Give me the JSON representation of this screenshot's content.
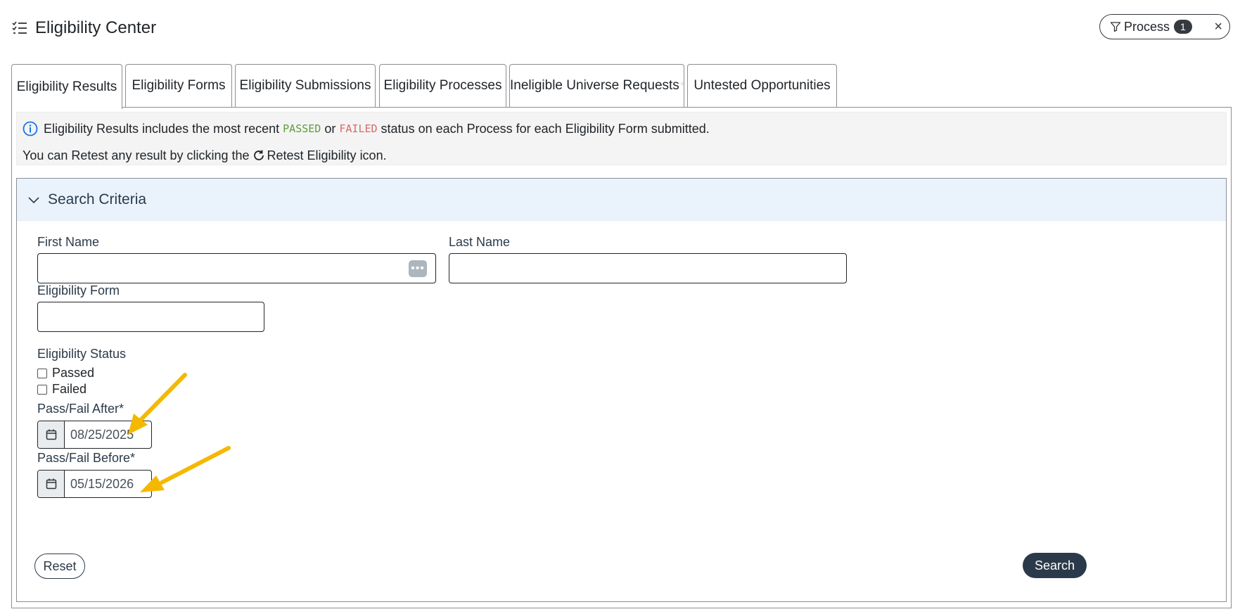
{
  "header": {
    "title": "Eligibility Center",
    "icon": "list-check-icon"
  },
  "filter_pill": {
    "label": "Process",
    "count": "1",
    "close": "×"
  },
  "tabs": [
    {
      "label": "Eligibility Results",
      "active": true
    },
    {
      "label": "Eligibility Forms"
    },
    {
      "label": "Eligibility Submissions"
    },
    {
      "label": "Eligibility Processes"
    },
    {
      "label": "Ineligible Universe Requests",
      "has_help_icon": true
    },
    {
      "label": "Untested Opportunities"
    }
  ],
  "info": {
    "line1_prefix": "Eligibility Results includes the most recent",
    "passed": "PASSED",
    "or": "or",
    "failed": "FAILED",
    "line1_suffix": "status on each Process for each Eligibility Form submitted.",
    "line2_prefix": "You can Retest any result by clicking the",
    "line2_suffix": "Retest Eligibility icon."
  },
  "search_criteria": {
    "title": "Search Criteria",
    "first_name": {
      "label": "First Name",
      "value": ""
    },
    "last_name": {
      "label": "Last Name",
      "value": ""
    },
    "eligibility_form": {
      "label": "Eligibility Form",
      "value": ""
    },
    "status": {
      "label": "Eligibility Status",
      "options": [
        {
          "label": "Passed",
          "checked": false
        },
        {
          "label": "Failed",
          "checked": false
        }
      ]
    },
    "pass_fail_after": {
      "label": "Pass/Fail After*",
      "value": "08/25/2025"
    },
    "pass_fail_before": {
      "label": "Pass/Fail Before*",
      "value": "05/15/2026"
    },
    "reset_label": "Reset",
    "search_label": "Search"
  },
  "colors": {
    "passed": "#5a9e3a",
    "failed": "#d86a6a",
    "primary": "#2b3a4a",
    "header_bg": "#eaf3fc",
    "annotation_arrow": "#f5b800"
  }
}
